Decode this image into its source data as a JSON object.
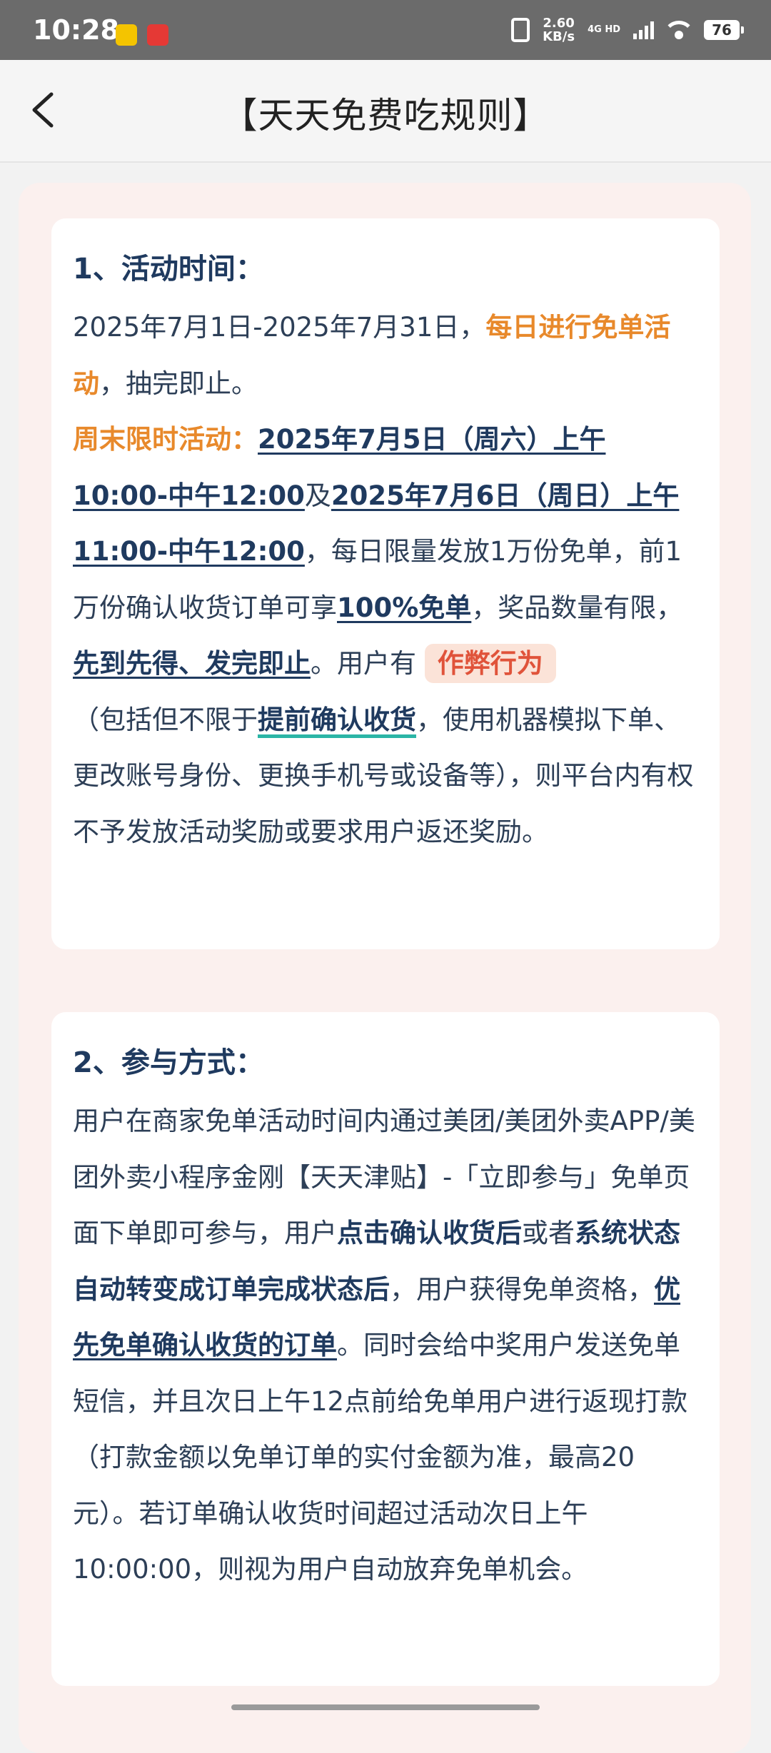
{
  "status_bar": {
    "time": "10:28",
    "speed_value": "2.60",
    "speed_unit": "KB/s",
    "net_type": "4G HD",
    "battery": "76"
  },
  "header": {
    "title": "【天天免费吃规则】"
  },
  "sections": [
    {
      "title": "1、活动时间：",
      "p1": "2025年7月1日-2025年7月31日，",
      "p1_highlight": "每日进行免单活动",
      "p1_end": "，抽完即止。",
      "weekend_label": "周末限时活动：",
      "weekend_date1": "2025年7月5日（周六）上午10:00-中午12:00",
      "weekend_and": "及",
      "weekend_date2": "2025年7月6日（周日）上午11:00-中午12:00",
      "weekend_text1": "，每日限量发放1万份免单，前1万份确认收货订单可享",
      "free_100": "100%免单",
      "weekend_text2": "，奖品数量有限，",
      "first_come": "先到先得、发完即止",
      "user_has": "。用户有",
      "cheat_badge": "作弊行为",
      "paren_start": "（包括但不限于",
      "early_confirm": "提前确认收货",
      "cheat_desc": "，使用机器模拟下单、更改账号身份、更换手机号或设备等），则平台内有权不予发放活动奖励或要求用户返还奖励。"
    },
    {
      "title": "2、参与方式：",
      "p1": "用户在商家免单活动时间内通过美团/美团外卖APP/美团外卖小程序金刚【天天津贴】-「立即参与」免单页面下单即可参与，用户",
      "bold1": "点击确认收货后",
      "or": "或者",
      "bold2": "系统状态自动转变成订单完成状态后",
      "p2": "，用户获得免单资格，",
      "priority": "优先免单确认收货的订单",
      "p3": "。同时会给中奖用户发送免单短信，并且次日上午12点前给免单用户进行返现打款（打款金额以免单订单的实付金额为准，最高20元）。若订单确认收货时间超过活动次日上午10:00:00，则视为用户自动放弃免单机会。"
    }
  ]
}
